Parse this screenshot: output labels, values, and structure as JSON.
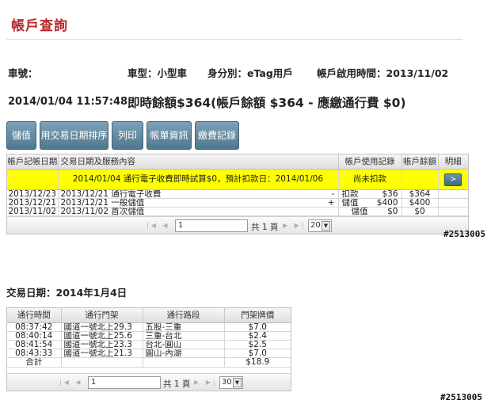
{
  "header": {
    "title": "帳戶查詢"
  },
  "info": {
    "plate_label": "車號：",
    "vehicle_type": "車型：小型車",
    "identity": "身分別：eTag用戶",
    "activation": "帳戶啟用時間：2013/11/02",
    "timestamp": "2014/01/04 11:57:48",
    "balance_text": "即時餘額$364(帳戶餘額 $364 - 應繳通行費 $0)"
  },
  "toolbar": {
    "topup": "儲值",
    "sort_by_date": "用交易日期排序",
    "print": "列印",
    "billing_info": "帳單資訊",
    "payment_records": "繳費記錄"
  },
  "account_grid": {
    "headers": [
      "帳戶記帳日期",
      "交易日期及服務內容",
      "帳戶使用記錄",
      "帳戶餘額",
      "明細"
    ],
    "pending_row": {
      "description": "2014/01/04 通行電子收費即時試算$0，預計扣款日：2014/01/06",
      "status": "尚未扣款",
      "detail_button": ">"
    },
    "rows": [
      {
        "post_date": "2013/12/23",
        "desc": "2013/12/21 通行電子收費",
        "sign": "-",
        "type": "扣款",
        "amount": "$36",
        "balance": "$364"
      },
      {
        "post_date": "2013/12/21",
        "desc": "2013/12/21 一般儲值",
        "sign": "+",
        "type": "儲值",
        "amount": "$400",
        "balance": "$400"
      },
      {
        "post_date": "2013/11/02",
        "desc": "2013/11/02 首次儲值",
        "sign": "",
        "type": "儲值",
        "amount": "$0",
        "balance": "$0"
      }
    ],
    "pager": {
      "page": "1",
      "total": "共 1 頁",
      "page_size": "20"
    }
  },
  "watermark": "#2513005",
  "transactions": {
    "date_label": "交易日期：2014年1月4日",
    "headers": [
      "通行時間",
      "通行門架",
      "通行路段",
      "門架牌價"
    ],
    "rows": [
      {
        "time": "08:37:42",
        "gantry": "國道一號北上29.3",
        "segment": "五股-三重",
        "price": "$7.0"
      },
      {
        "time": "08:40:14",
        "gantry": "國道一號北上25.6",
        "segment": "三重-台北",
        "price": "$2.4"
      },
      {
        "time": "08:41:54",
        "gantry": "國道一號北上23.3",
        "segment": "台北-圓山",
        "price": "$2.5"
      },
      {
        "time": "08:43:33",
        "gantry": "國道一號北上21.3",
        "segment": "圓山-內湖",
        "price": "$7.0"
      }
    ],
    "total_label": "合計",
    "total_value": "$18.9",
    "pager": {
      "page": "1",
      "total": "共 1 頁",
      "page_size": "30"
    }
  }
}
